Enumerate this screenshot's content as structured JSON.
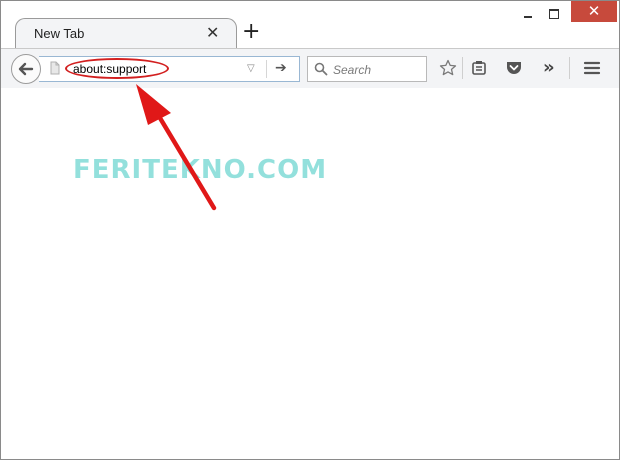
{
  "window": {
    "close_glyph": "✕"
  },
  "tab": {
    "title": "New Tab",
    "close_glyph": "✕"
  },
  "toolbar": {
    "new_tab_glyph": "+",
    "url": "about:support",
    "dropmarker_glyph": "▽",
    "go_glyph": "➔",
    "search_placeholder": "Search",
    "overflow_glyph": "»"
  },
  "content": {
    "watermark": "FERITEKNO.COM"
  },
  "colors": {
    "annotation_red": "#d21f1f",
    "watermark": "#6fd6d1"
  },
  "icons": [
    "back-icon",
    "page-icon",
    "search-icon",
    "bookmark-star-icon",
    "reading-list-icon",
    "pocket-icon",
    "overflow-icon",
    "menu-icon"
  ]
}
